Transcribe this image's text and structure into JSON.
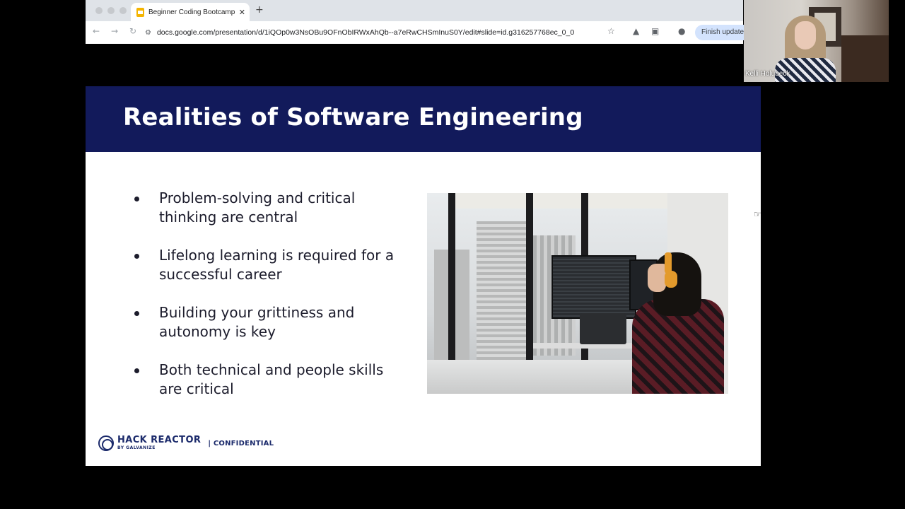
{
  "browser": {
    "tab_title": "Beginner Coding Bootcamp C",
    "tab_close": "✕",
    "new_tab": "+",
    "url": "docs.google.com/presentation/d/1iQOp0w3NsOBu9OFnObIRWxAhQb--a7eRwCHSmInuS0Y/edit#slide=id.g316257768ec_0_0",
    "finish_update_label": "Finish update",
    "icons": [
      "back-icon",
      "forward-icon",
      "reload-icon",
      "site-info-icon",
      "star-icon",
      "extension-icon",
      "puzzle-icon",
      "profile-icon"
    ]
  },
  "webcam": {
    "participant_name": "Kelli Holubeck"
  },
  "slide": {
    "title": "Realities of Software Engineering",
    "bullets": [
      "Problem-solving and critical thinking are central",
      "Lifelong learning is required for a successful career",
      "Building your grittiness and autonomy is key",
      "Both technical and people skills are critical"
    ],
    "photo_alt": "Person with headphones working at multiple monitors by a window",
    "header_color": "#121a5b",
    "footer": {
      "logo_main": "HACK REACTOR",
      "logo_sub": "BY GALVANIZE",
      "separator_label": "| CONFIDENTIAL"
    }
  }
}
